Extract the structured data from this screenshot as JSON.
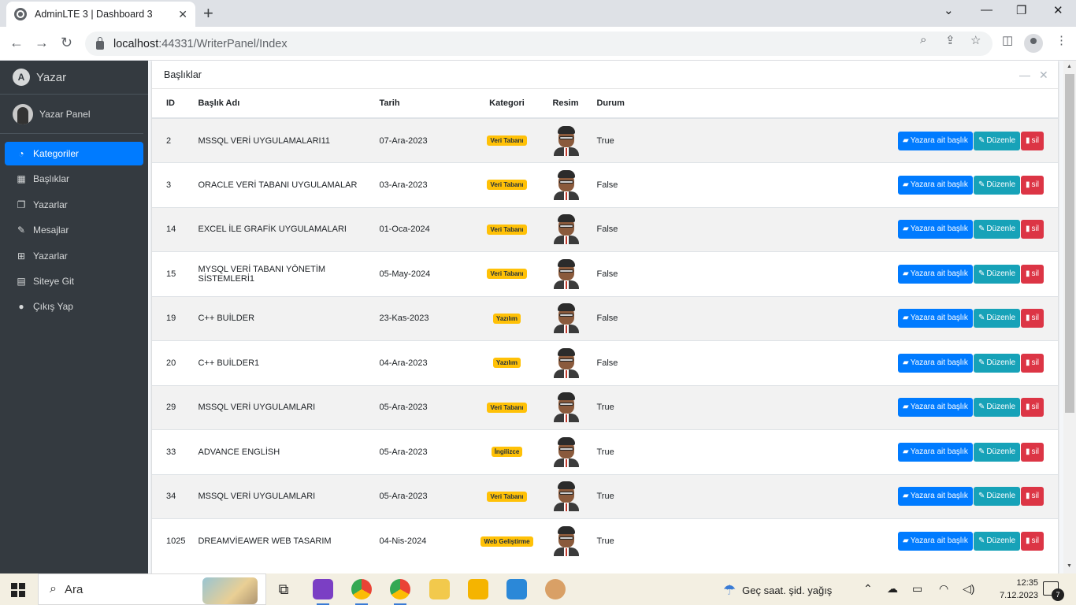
{
  "browser": {
    "tab_title": "AdminLTE 3 | Dashboard 3",
    "tab_close": "✕",
    "new_tab": "+",
    "url_host": "localhost",
    "url_path": ":44331/WriterPanel/Index"
  },
  "sidebar": {
    "brand": "Yazar",
    "brand_letter": "A",
    "user_name": "Yazar Panel",
    "items": [
      {
        "label": "Kategoriler",
        "icon": "dashboard-icon",
        "glyph": "◔",
        "active": true
      },
      {
        "label": "Başlıklar",
        "icon": "grid-icon",
        "glyph": "▦",
        "active": false
      },
      {
        "label": "Yazarlar",
        "icon": "copy-icon",
        "glyph": "❐",
        "active": false
      },
      {
        "label": "Mesajlar",
        "icon": "edit-icon",
        "glyph": "✎",
        "active": false
      },
      {
        "label": "Yazarlar",
        "icon": "table-icon",
        "glyph": "⊞",
        "active": false
      },
      {
        "label": "Siteye Git",
        "icon": "book-icon",
        "glyph": "▤",
        "active": false
      },
      {
        "label": "Çıkış Yap",
        "icon": "apple-icon",
        "glyph": "●",
        "active": false
      }
    ]
  },
  "card": {
    "title": "Başlıklar",
    "minimize": "—",
    "close": "✕"
  },
  "table": {
    "headers": {
      "id": "ID",
      "title": "Başlık Adı",
      "date": "Tarih",
      "category": "Kategori",
      "image": "Resim",
      "status": "Durum"
    },
    "rows": [
      {
        "id": "2",
        "title": "MSSQL VERİ UYGULAMALARI11",
        "date": "07-Ara-2023",
        "category": "Veri Tabanı",
        "status": "True"
      },
      {
        "id": "3",
        "title": "ORACLE VERİ TABANI UYGULAMALAR",
        "date": "03-Ara-2023",
        "category": "Veri Tabanı",
        "status": "False"
      },
      {
        "id": "14",
        "title": "EXCEL İLE GRAFİK UYGULAMALARI",
        "date": "01-Oca-2024",
        "category": "Veri Tabanı",
        "status": "False"
      },
      {
        "id": "15",
        "title": "MYSQL VERİ TABANI YÖNETİM SİSTEMLERİ1",
        "date": "05-May-2024",
        "category": "Veri Tabanı",
        "status": "False"
      },
      {
        "id": "19",
        "title": "C++ BUİLDER",
        "date": "23-Kas-2023",
        "category": "Yazılım",
        "status": "False"
      },
      {
        "id": "20",
        "title": "C++ BUİLDER1",
        "date": "04-Ara-2023",
        "category": "Yazılım",
        "status": "False"
      },
      {
        "id": "29",
        "title": "MSSQL VERİ UYGULAMLARI",
        "date": "05-Ara-2023",
        "category": "Veri Tabanı",
        "status": "True"
      },
      {
        "id": "33",
        "title": "ADVANCE ENGLİSH",
        "date": "05-Ara-2023",
        "category": "İngilizce",
        "status": "True"
      },
      {
        "id": "34",
        "title": "MSSQL VERİ UYGULAMLARI",
        "date": "05-Ara-2023",
        "category": "Veri Tabanı",
        "status": "True"
      },
      {
        "id": "1025",
        "title": "DREAMVİEAWER WEB TASARIM",
        "date": "04-Nis-2024",
        "category": "Web Geliştirme",
        "status": "True"
      }
    ],
    "actions": {
      "writer": "Yazara ait başlık",
      "edit": "Düzenle",
      "delete": "sil"
    }
  },
  "taskbar": {
    "search_placeholder": "Ara",
    "weather": "Geç saat. şid. yağış",
    "time": "12:35",
    "date": "7.12.2023",
    "notifications": "7"
  },
  "colors": {
    "sidebar_bg": "#343a40",
    "active": "#007bff",
    "info": "#17a2b8",
    "danger": "#dc3545",
    "badge": "#ffc107"
  }
}
